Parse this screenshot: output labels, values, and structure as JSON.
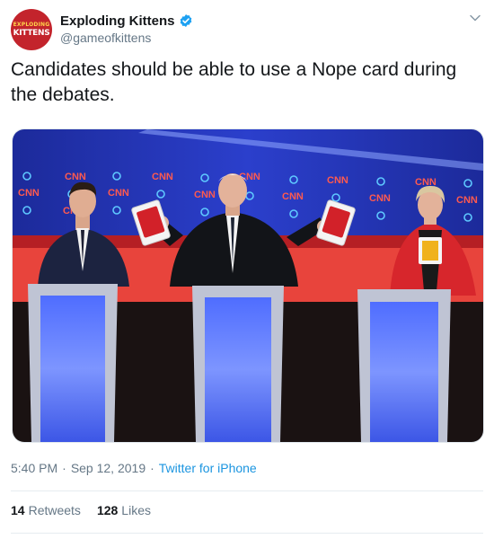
{
  "account": {
    "avatar_line1": "EXPLODING",
    "avatar_line2": "KITTENS",
    "display_name": "Exploding Kittens",
    "handle": "@gameofkittens",
    "verified": true
  },
  "tweet": {
    "text": "Candidates should be able to use a Nope card during the debates."
  },
  "media": {
    "logo_text": "CNN"
  },
  "meta": {
    "time": "5:40 PM",
    "separator": "·",
    "date": "Sep 12, 2019",
    "source": "Twitter for iPhone"
  },
  "stats": {
    "retweets_count": "14",
    "retweets_label": "Retweets",
    "likes_count": "128",
    "likes_label": "Likes"
  },
  "icons": {
    "verified": "verified-badge-icon",
    "caret": "chevron-down-icon"
  },
  "colors": {
    "avatar": "#c3242c",
    "link": "#1b95e0",
    "verified": "#1da1f2",
    "muted": "#657786"
  }
}
